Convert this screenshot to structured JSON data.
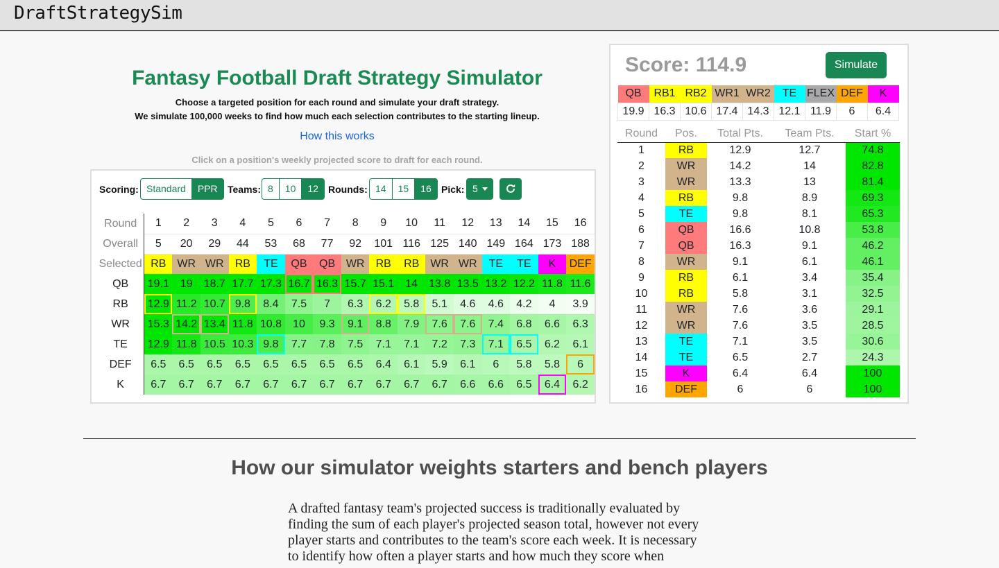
{
  "app": {
    "brand": "DraftStrategySim"
  },
  "header": {
    "title": "Fantasy Football Draft Strategy Simulator",
    "subtitle1": "Choose a targeted position for each round and simulate your draft strategy.",
    "subtitle2": "We simulate 100,000 weeks to find how much each selection contributes to the starting lineup.",
    "how_link": "How this works",
    "hint": "Click on a position's weekly projected score to draft for each round."
  },
  "controls": {
    "scoring_label": "Scoring:",
    "scoring_options": [
      "Standard",
      "PPR"
    ],
    "scoring_selected": "PPR",
    "teams_label": "Teams:",
    "teams_options": [
      "8",
      "10",
      "12"
    ],
    "teams_selected": "12",
    "rounds_label": "Rounds:",
    "rounds_options": [
      "14",
      "15",
      "16"
    ],
    "rounds_selected": "16",
    "pick_label": "Pick:",
    "pick_value": "5",
    "refresh_icon": "refresh-icon"
  },
  "draft_board": {
    "round_label": "Round",
    "overall_label": "Overall",
    "selected_label": "Selected",
    "rounds": [
      "1",
      "2",
      "3",
      "4",
      "5",
      "6",
      "7",
      "8",
      "9",
      "10",
      "11",
      "12",
      "13",
      "14",
      "15",
      "16"
    ],
    "overall": [
      "5",
      "20",
      "29",
      "44",
      "53",
      "68",
      "77",
      "92",
      "101",
      "116",
      "125",
      "140",
      "149",
      "164",
      "173",
      "188"
    ],
    "selected": [
      "RB",
      "WR",
      "WR",
      "RB",
      "TE",
      "QB",
      "QB",
      "WR",
      "RB",
      "RB",
      "WR",
      "WR",
      "TE",
      "TE",
      "K",
      "DEF"
    ],
    "positions": [
      "QB",
      "RB",
      "WR",
      "TE",
      "DEF",
      "K"
    ],
    "values": {
      "QB": [
        "19.1",
        "19",
        "18.7",
        "17.7",
        "17.3",
        "16.7",
        "16.3",
        "15.7",
        "15.1",
        "14",
        "13.8",
        "13.5",
        "13.2",
        "12.2",
        "11.8",
        "11.6"
      ],
      "RB": [
        "12.9",
        "11.2",
        "10.7",
        "9.8",
        "8.4",
        "7.5",
        "7",
        "6.3",
        "6.2",
        "5.8",
        "5.1",
        "4.6",
        "4.6",
        "4.2",
        "4",
        "3.9"
      ],
      "WR": [
        "15.3",
        "14.2",
        "13.4",
        "11.8",
        "10.8",
        "10",
        "9.3",
        "9.1",
        "8.8",
        "7.9",
        "7.6",
        "7.6",
        "7.4",
        "6.8",
        "6.6",
        "6.3"
      ],
      "TE": [
        "12.9",
        "11.8",
        "10.5",
        "10.3",
        "9.8",
        "7.7",
        "7.8",
        "7.5",
        "7.1",
        "7.1",
        "7.2",
        "7.3",
        "7.1",
        "6.5",
        "6.2",
        "6.1"
      ],
      "DEF": [
        "6.5",
        "6.5",
        "6.5",
        "6.5",
        "6.5",
        "6.5",
        "6.5",
        "6.5",
        "6.4",
        "6.1",
        "5.9",
        "6.1",
        "6",
        "5.8",
        "5.8",
        "6"
      ],
      "K": [
        "6.7",
        "6.7",
        "6.7",
        "6.7",
        "6.7",
        "6.7",
        "6.7",
        "6.7",
        "6.7",
        "6.7",
        "6.7",
        "6.6",
        "6.6",
        "6.5",
        "6.4",
        "6.2"
      ]
    }
  },
  "score": {
    "label": "Score: 114.9",
    "simulate_label": "Simulate",
    "lineup_positions": [
      "QB",
      "RB1",
      "RB2",
      "WR1",
      "WR2",
      "TE",
      "FLEX",
      "DEF",
      "K"
    ],
    "lineup_values": [
      "19.9",
      "16.3",
      "10.6",
      "17.4",
      "14.3",
      "12.1",
      "11.9",
      "6",
      "6.4"
    ],
    "table_headers": [
      "Round",
      "Pos.",
      "Total Pts.",
      "Team Pts.",
      "Start %"
    ],
    "rows": [
      [
        "1",
        "RB",
        "12.9",
        "12.7",
        "74.8"
      ],
      [
        "2",
        "WR",
        "14.2",
        "14",
        "82.8"
      ],
      [
        "3",
        "WR",
        "13.3",
        "13",
        "81.4"
      ],
      [
        "4",
        "RB",
        "9.8",
        "8.9",
        "69.3"
      ],
      [
        "5",
        "TE",
        "9.8",
        "8.1",
        "65.3"
      ],
      [
        "6",
        "QB",
        "16.6",
        "10.8",
        "53.8"
      ],
      [
        "7",
        "QB",
        "16.3",
        "9.1",
        "46.2"
      ],
      [
        "8",
        "WR",
        "9.1",
        "6.1",
        "46.1"
      ],
      [
        "9",
        "RB",
        "6.1",
        "3.4",
        "35.4"
      ],
      [
        "10",
        "RB",
        "5.8",
        "3.1",
        "32.5"
      ],
      [
        "11",
        "WR",
        "7.6",
        "3.6",
        "29.1"
      ],
      [
        "12",
        "WR",
        "7.6",
        "3.5",
        "28.5"
      ],
      [
        "13",
        "TE",
        "7.1",
        "3.5",
        "30.6"
      ],
      [
        "14",
        "TE",
        "6.5",
        "2.7",
        "24.3"
      ],
      [
        "15",
        "K",
        "6.4",
        "6.4",
        "100"
      ],
      [
        "16",
        "DEF",
        "6",
        "6",
        "100"
      ]
    ]
  },
  "colors": {
    "QB": "#ff7b7b",
    "RB": "#ffff00",
    "WR": "#d2b48c",
    "TE": "#00ffff",
    "FLEX": "#a9a9a9",
    "DEF": "#ffa500",
    "K": "#ff00ff",
    "accent": "#198754"
  },
  "article": {
    "heading": "How our simulator weights starters and bench players",
    "paragraph": "A drafted fantasy team's projected success is traditionally evaluated by finding the sum of each player's projected season total, however not every player starts and contributes to the team's score each week. It is necessary to identify how often a player starts and how much they score when"
  }
}
